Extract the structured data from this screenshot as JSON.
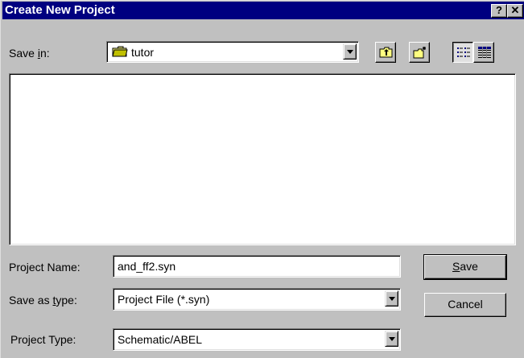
{
  "window": {
    "title": "Create New Project",
    "help_label": "?",
    "close_label": "✕"
  },
  "save_in": {
    "label_pre": "Save ",
    "label_accel": "i",
    "label_post": "n:",
    "value": "tutor",
    "icon": "folder-icon"
  },
  "toolbar": {
    "buttons": [
      {
        "name": "up-one-level",
        "icon": "folder-up-icon"
      },
      {
        "name": "create-new-folder",
        "icon": "new-folder-icon"
      },
      {
        "name": "list-view",
        "icon": "list-view-icon",
        "pressed": true
      },
      {
        "name": "details-view",
        "icon": "details-view-icon"
      }
    ]
  },
  "file_list": {
    "items": []
  },
  "project_name": {
    "label": "Project Name:",
    "value": "and_ff2.syn"
  },
  "save_as_type": {
    "label_pre": "Save as ",
    "label_accel": "t",
    "label_post": "ype:",
    "value": "Project File (*.syn)"
  },
  "project_type": {
    "label": "Project Type:",
    "value": "Schematic/ABEL"
  },
  "buttons": {
    "save_accel": "S",
    "save_rest": "ave",
    "cancel": "Cancel"
  },
  "colors": {
    "titlebar": "#000080",
    "face": "#c0c0c0",
    "field": "#ffffff",
    "folder": "#ffff80"
  }
}
